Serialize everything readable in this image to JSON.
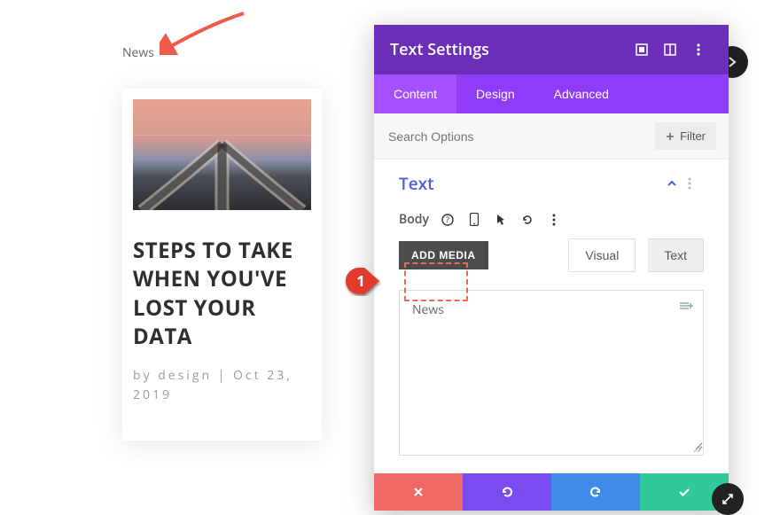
{
  "preview": {
    "label": "News",
    "card": {
      "title": "STEPS TO TAKE WHEN YOU'VE LOST YOUR DATA",
      "meta": "by design | Oct 23, 2019"
    }
  },
  "panel": {
    "title": "Text Settings",
    "tabs": {
      "content": "Content",
      "design": "Design",
      "advanced": "Advanced",
      "active": "content"
    },
    "search": {
      "placeholder": "Search Options"
    },
    "filter_label": "Filter",
    "section": {
      "title": "Text"
    },
    "body_label": "Body",
    "add_media_label": "ADD MEDIA",
    "modes": {
      "visual": "Visual",
      "text": "Text",
      "active": "text"
    },
    "editor_value": "News"
  },
  "step": {
    "number": "1"
  },
  "icons": {
    "expand": "expand-icon",
    "split": "split-view-icon",
    "kebab": "kebab-menu-icon",
    "plus": "plus-icon",
    "chevron_up": "chevron-up-icon",
    "help": "help-icon",
    "mobile": "mobile-icon",
    "cursor": "cursor-icon",
    "reset": "reset-icon",
    "dynamic": "dynamic-content-icon",
    "close": "close-icon",
    "undo": "undo-icon",
    "redo": "redo-icon",
    "check": "check-icon",
    "resize": "resize-icon"
  }
}
